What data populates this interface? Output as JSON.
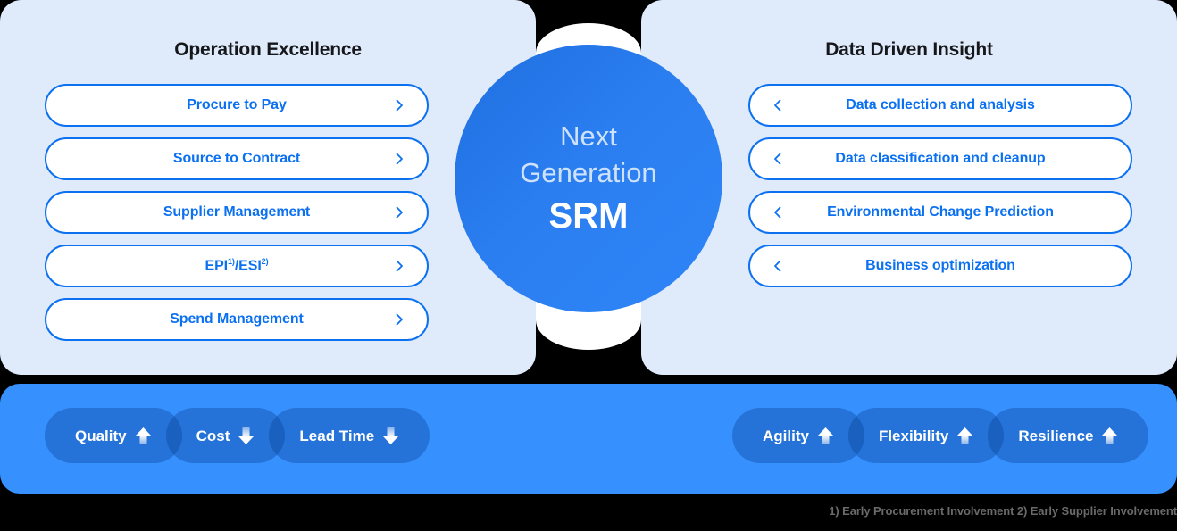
{
  "left_panel": {
    "title": "Operation Excellence",
    "items": [
      {
        "label": "Procure to Pay",
        "icon": "chevron-right-icon"
      },
      {
        "label": "Source to Contract",
        "icon": "chevron-right-icon"
      },
      {
        "label": "Supplier Management",
        "icon": "chevron-right-icon"
      },
      {
        "label": "EPI1)/ESI2)",
        "icon": "chevron-right-icon",
        "html": "EPI<sup>1)</sup>/ESI<sup>2)</sup>"
      },
      {
        "label": "Spend Management",
        "icon": "chevron-right-icon"
      }
    ]
  },
  "right_panel": {
    "title": "Data Driven Insight",
    "items": [
      {
        "label": "Data collection and analysis",
        "icon": "chevron-left-icon"
      },
      {
        "label": "Data classification and cleanup",
        "icon": "chevron-left-icon"
      },
      {
        "label": "Environmental Change Prediction",
        "icon": "chevron-left-icon"
      },
      {
        "label": "Business optimization",
        "icon": "chevron-left-icon"
      }
    ]
  },
  "core": {
    "line1": "Next",
    "line2": "Generation",
    "line3": "SRM"
  },
  "outcomes": {
    "left_group": [
      {
        "label": "Quality",
        "trend": "up",
        "icon": "arrow-up-icon"
      },
      {
        "label": "Cost",
        "trend": "down",
        "icon": "arrow-down-icon"
      },
      {
        "label": "Lead Time",
        "trend": "down",
        "icon": "arrow-down-icon"
      }
    ],
    "right_group": [
      {
        "label": "Agility",
        "trend": "up",
        "icon": "arrow-up-icon"
      },
      {
        "label": "Flexibility",
        "trend": "up",
        "icon": "arrow-up-icon"
      },
      {
        "label": "Resilience",
        "trend": "up",
        "icon": "arrow-up-icon"
      }
    ]
  },
  "footnote": "1) Early Procurement Involvement 2) Early Supplier Involvement",
  "colors": {
    "panel_background": "#dfeafa",
    "accent_blue": "#0c71f0",
    "bar_blue": "#3690fe",
    "pill_blue": "#1f66cc",
    "circle_blue": "#2b7ef0",
    "page_background": "#000000",
    "footnote_text": "#6a6a6a"
  }
}
